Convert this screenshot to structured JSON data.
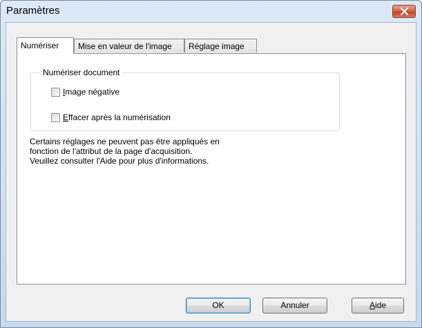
{
  "window": {
    "title": "Paramètres"
  },
  "tabs": [
    {
      "label": "Numériser",
      "active": true
    },
    {
      "label": "Mise en valeur de l'image",
      "active": false
    },
    {
      "label": "Réglage image",
      "active": false
    }
  ],
  "group": {
    "legend": "Numériser document",
    "options": [
      {
        "mnemonic": "I",
        "rest": "mage négative",
        "checked": false
      },
      {
        "mnemonic": "E",
        "rest": "ffacer après la numérisation",
        "checked": false
      }
    ]
  },
  "note": [
    "Certains réglages ne peuvent pas être appliqués en",
    "fonction de l'attribut de la page d'acquisition.",
    "Veuillez consulter l'Aide pour plus d'informations."
  ],
  "buttons": {
    "ok": "OK",
    "cancel": "Annuler",
    "help_mnemonic": "A",
    "help_rest": "ide"
  },
  "colors": {
    "close_button": "#c4442a",
    "default_button_border": "#3c7fb1"
  }
}
